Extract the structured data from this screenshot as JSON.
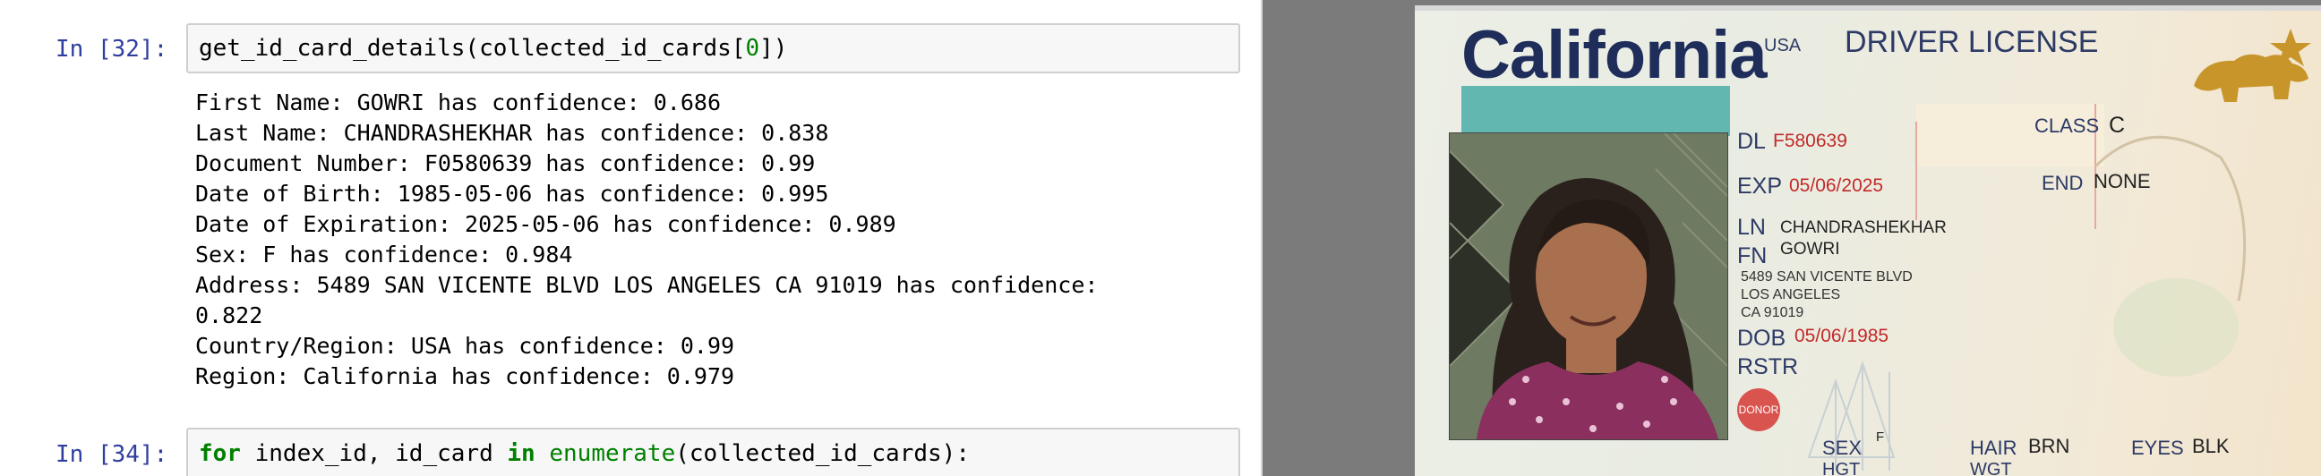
{
  "notebook": {
    "cell1": {
      "prompt": "In [32]:",
      "code_pre": "get_id_card_details(collected_id_cards[",
      "code_idx": "0",
      "code_post": "])"
    },
    "output_lines": [
      "First Name: GOWRI has confidence: 0.686",
      "Last Name: CHANDRASHEKHAR has confidence: 0.838",
      "Document Number: F0580639 has confidence: 0.99",
      "Date of Birth: 1985-05-06 has confidence: 0.995",
      "Date of Expiration: 2025-05-06 has confidence: 0.989",
      "Sex: F has confidence: 0.984",
      "Address: 5489 SAN VICENTE BLVD LOS ANGELES CA 91019 has confidence:",
      "0.822",
      "Country/Region: USA has confidence: 0.99",
      "Region: California has confidence: 0.979"
    ],
    "cell2": {
      "prompt": "In [34]:",
      "kw_for": "for",
      "var": " index_id, id_card ",
      "kw_in": "in",
      "builtin": " enumerate",
      "rest": "(collected_id_cards):"
    }
  },
  "id_card": {
    "state": "California",
    "country": "USA",
    "title": "DRIVER LICENSE",
    "dl_label": "DL",
    "dl_value": "F580639",
    "exp_label": "EXP",
    "exp_value": "05/06/2025",
    "ln_label": "LN",
    "ln_value": "CHANDRASHEKHAR",
    "fn_label": "FN",
    "fn_value": "GOWRI",
    "address_line1": "5489 SAN VICENTE BLVD",
    "address_line2": "LOS ANGELES",
    "address_line3": "CA 91019",
    "dob_label": "DOB",
    "dob_value": "05/06/1985",
    "rstr_label": "RSTR",
    "class_label": "CLASS",
    "class_value": "C",
    "end_label": "END",
    "end_value": "NONE",
    "donor": "DONOR",
    "sex_label": "SEX",
    "sex_value": "F",
    "hair_label": "HAIR",
    "hair_value": "BRN",
    "eyes_label": "EYES",
    "eyes_value": "BLK",
    "hgt_label": "HGT",
    "wgt_label": "WGT"
  },
  "colors": {
    "prompt": "#303f9f",
    "keyword": "#008000",
    "card_text": "#2d3a66",
    "card_red": "#c22a2a"
  }
}
